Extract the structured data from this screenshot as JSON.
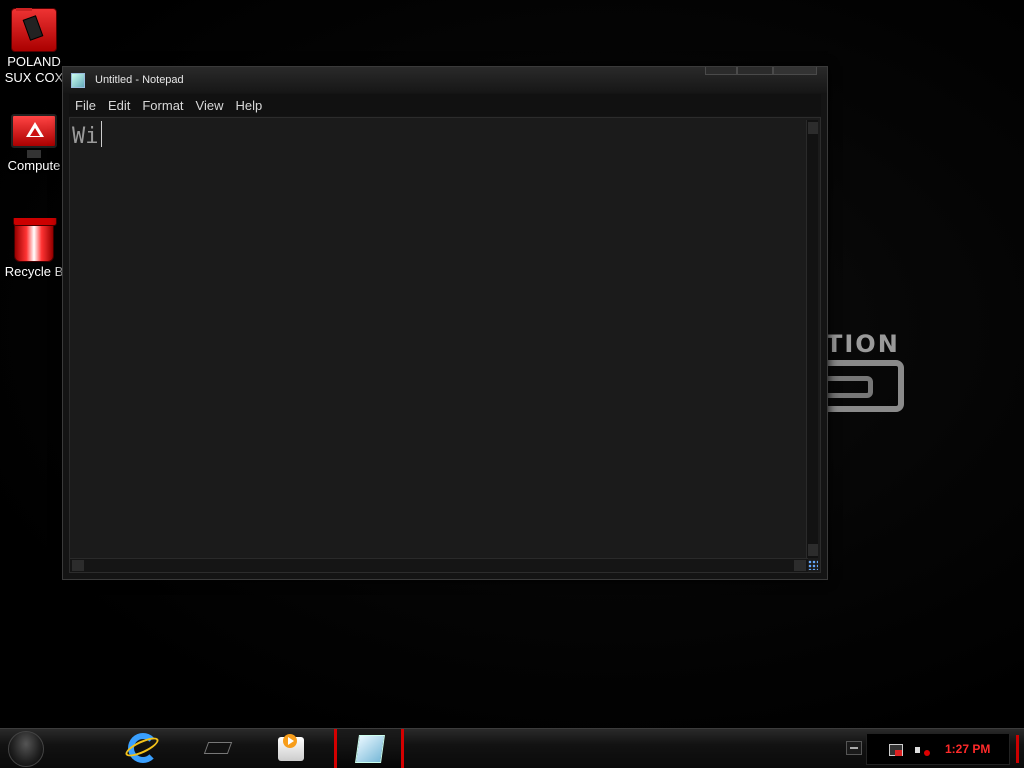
{
  "desktop": {
    "icons": [
      {
        "label": "POLAND\nSUX COX",
        "icon": "folder-icon"
      },
      {
        "label": "Compute",
        "icon": "computer-icon"
      },
      {
        "label": "Recycle B",
        "icon": "recycle-bin-icon"
      }
    ],
    "wallpaper_text": "TION"
  },
  "window": {
    "title": "Untitled - Notepad",
    "menu": [
      "File",
      "Edit",
      "Format",
      "View",
      "Help"
    ],
    "editor_text": "Wi"
  },
  "taskbar": {
    "start": "alienware-start-icon",
    "pinned": [
      "internet-explorer-icon",
      "windows-explorer-icon",
      "media-player-icon",
      "notepad-icon"
    ],
    "active": "notepad-icon",
    "clock": "1:27 PM",
    "colors": {
      "accent": "#d40000",
      "clock": "#ff2a2a"
    }
  }
}
